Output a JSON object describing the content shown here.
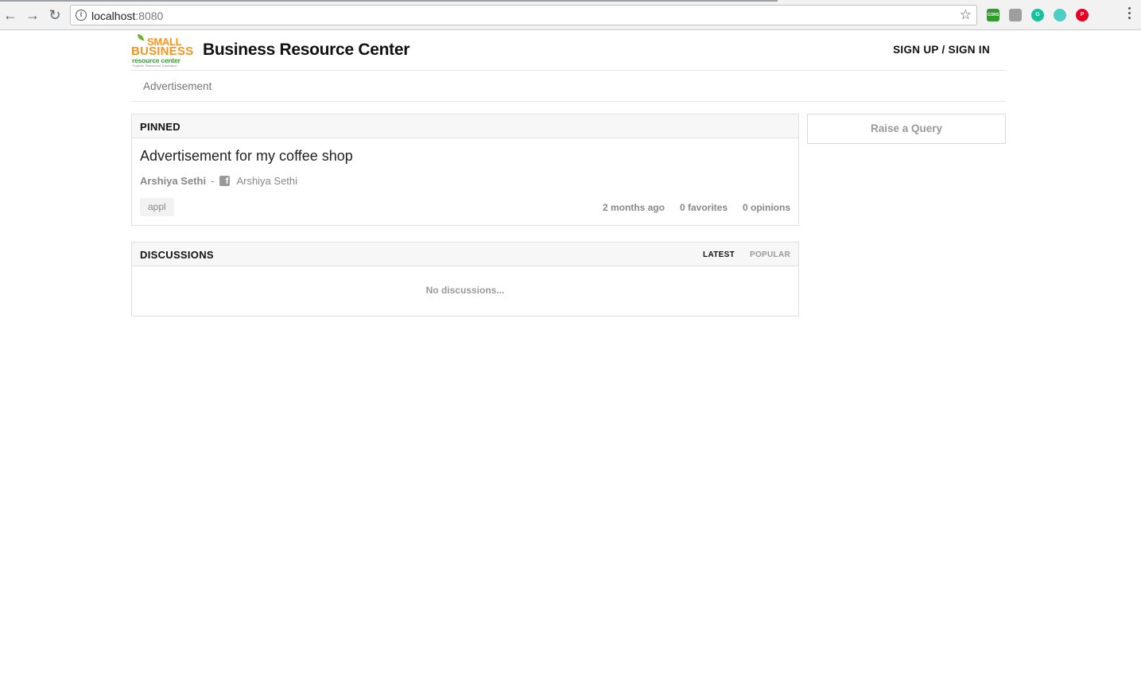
{
  "browser": {
    "url_host": "localhost",
    "url_port": ":8080",
    "back_icon": "←",
    "forward_icon": "→",
    "reload_icon": "↻",
    "star_icon": "☆",
    "extensions": [
      {
        "name": "cors-extension-icon",
        "label": "CORS",
        "color": "#2e9d2e"
      },
      {
        "name": "profile-extension-icon",
        "label": "",
        "color": "#9e9e9e"
      },
      {
        "name": "grammarly-extension-icon",
        "label": "G",
        "color": "#15c39a"
      },
      {
        "name": "circle-extension-icon",
        "label": "",
        "color": "#4ecdc4"
      },
      {
        "name": "pinterest-extension-icon",
        "label": "P",
        "color": "#e60023"
      }
    ]
  },
  "header": {
    "logo": {
      "line1": "SMALL",
      "line2": "BUSINESS",
      "line3": "resource center",
      "tagline": "Experts. Resources. Inspiration."
    },
    "site_title": "Business Resource Center",
    "auth_label": "SIGN UP / SIGN IN"
  },
  "adbar": {
    "label": "Advertisement"
  },
  "pinned": {
    "heading": "PINNED",
    "post": {
      "title": "Advertisement for my coffee shop",
      "author": "Arshiya Sethi",
      "separator": "-",
      "social_name": "Arshiya Sethi",
      "tag": "appl",
      "time": "2 months ago",
      "favorites": "0 favorites",
      "opinions": "0 opinions"
    }
  },
  "discussions": {
    "heading": "DISCUSSIONS",
    "tabs": {
      "latest": "LATEST",
      "popular": "POPULAR"
    },
    "empty_text": "No discussions..."
  },
  "sidebar": {
    "raise_query_label": "Raise a Query"
  }
}
